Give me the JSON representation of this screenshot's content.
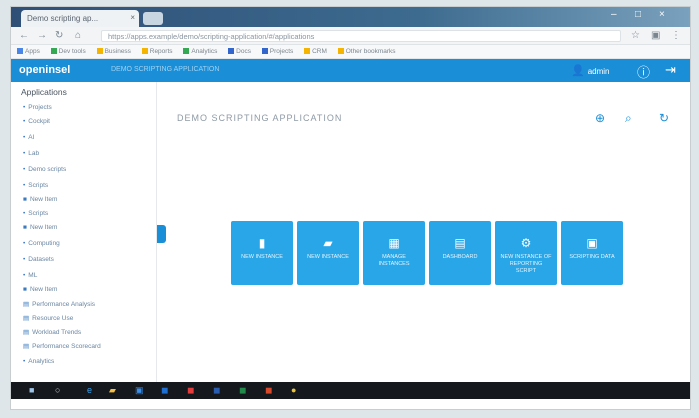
{
  "browser": {
    "tab_title": "Demo scripting ap...",
    "tab_close": "×",
    "url": "https://apps.example/demo/scripting-application/#/applications",
    "window_controls": [
      "–",
      "□",
      "×"
    ]
  },
  "bookmarks": [
    {
      "label": "Apps",
      "color": "#4a86e8"
    },
    {
      "label": "Dev tools",
      "color": "#34a853"
    },
    {
      "label": "Business",
      "color": "#f4b400"
    },
    {
      "label": "Reports",
      "color": "#f4b400"
    },
    {
      "label": "Analytics",
      "color": "#34a853"
    },
    {
      "label": "Docs",
      "color": "#3366cc"
    },
    {
      "label": "Projects",
      "color": "#3366cc"
    },
    {
      "label": "CRM",
      "color": "#f4b400"
    },
    {
      "label": "Other bookmarks",
      "color": "#f4b400"
    }
  ],
  "app": {
    "brand": "openinsel",
    "header_sub": "DEMO SCRIPTING APPLICATION",
    "user_name": "admin",
    "accent": "#1a8fd8",
    "tile_color": "#29a6e8"
  },
  "sidebar": {
    "title": "Applications",
    "items": [
      {
        "label": "Projects",
        "marker": "•"
      },
      {
        "label": "Cockpit",
        "marker": "•"
      },
      {
        "label": "AI",
        "marker": "•"
      },
      {
        "label": "Lab",
        "marker": "•"
      },
      {
        "label": "Demo scripts",
        "marker": "•"
      },
      {
        "label": "Scripts",
        "marker": "•"
      },
      {
        "label": "New Item",
        "marker": "■"
      },
      {
        "label": "Scripts",
        "marker": "•"
      },
      {
        "label": "New Item",
        "marker": "■"
      },
      {
        "label": "Computing",
        "marker": "•"
      },
      {
        "label": "Datasets",
        "marker": "•"
      },
      {
        "label": "ML",
        "marker": "•"
      },
      {
        "label": "New Item",
        "marker": "■"
      },
      {
        "label": "Performance Analysis",
        "marker": "▤"
      },
      {
        "label": "Resource Use",
        "marker": "▤"
      },
      {
        "label": "Workload Trends",
        "marker": "▤"
      },
      {
        "label": "Performance Scorecard",
        "marker": "▤"
      },
      {
        "label": "Analytics",
        "marker": "•"
      }
    ]
  },
  "main": {
    "title": "DEMO SCRIPTING APPLICATION",
    "tiles": [
      {
        "label": "NEW INSTANCE",
        "icon": "▮"
      },
      {
        "label": "NEW INSTANCE",
        "icon": "▰"
      },
      {
        "label": "MANAGE INSTANCES",
        "icon": "▦"
      },
      {
        "label": "DASHBOARD",
        "icon": "▤"
      },
      {
        "label": "NEW INSTANCE OF REPORTING SCRIPT",
        "icon": "⚙"
      },
      {
        "label": "SCRIPTING DATA",
        "icon": "▣"
      }
    ]
  },
  "taskbar": {
    "icons": [
      {
        "name": "start-icon",
        "glyph": "■",
        "color": "#9fc4e8"
      },
      {
        "name": "search-icon",
        "glyph": "○",
        "color": "#cfd6dd"
      },
      {
        "name": "browser-icon",
        "glyph": "e",
        "color": "#3aa0e8"
      },
      {
        "name": "folder-icon",
        "glyph": "▰",
        "color": "#f4c04a"
      },
      {
        "name": "store-icon",
        "glyph": "▣",
        "color": "#3a8ee8"
      },
      {
        "name": "outlook-icon",
        "glyph": "◼",
        "color": "#1f6fd1"
      },
      {
        "name": "pdf-icon",
        "glyph": "◼",
        "color": "#e23c3c"
      },
      {
        "name": "word-icon",
        "glyph": "◼",
        "color": "#2a5db0"
      },
      {
        "name": "excel-icon",
        "glyph": "◼",
        "color": "#218a4a"
      },
      {
        "name": "powerpoint-icon",
        "glyph": "◼",
        "color": "#d8492b"
      },
      {
        "name": "chrome-icon",
        "glyph": "●",
        "color": "#e7c23a"
      }
    ]
  }
}
